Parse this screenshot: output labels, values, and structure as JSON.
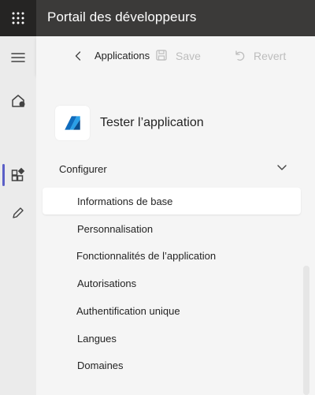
{
  "header": {
    "app_title": "Portail des développeurs",
    "waffle_icon": "waffle-icon"
  },
  "leftrail": {
    "items": [
      {
        "name": "hamburger-icon"
      },
      {
        "name": "home-icon"
      },
      {
        "name": "apps-icon",
        "active": true
      },
      {
        "name": "pencil-icon"
      }
    ],
    "accent": "#5b5fc7"
  },
  "toolbar": {
    "breadcrumb": "Applications",
    "save_label": "Save",
    "revert_label": "Revert"
  },
  "app": {
    "name": "Tester l’application",
    "logo_icon": "app-logo-icon"
  },
  "nav": {
    "section_label": "Configurer",
    "items": [
      {
        "label": "Informations de base",
        "selected": true
      },
      {
        "label": "Personnalisation"
      },
      {
        "label": "Fonctionnalités de l’application"
      },
      {
        "label": "Autorisations"
      },
      {
        "label": "Authentification unique"
      },
      {
        "label": "Langues"
      },
      {
        "label": "Domaines"
      }
    ]
  }
}
